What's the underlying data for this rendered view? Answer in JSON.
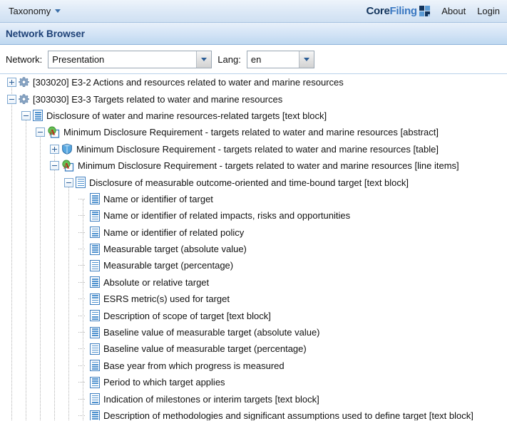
{
  "topbar": {
    "menu_label": "Taxonomy",
    "brand_core": "Core",
    "brand_filing": "Filing",
    "about_label": "About",
    "login_label": "Login"
  },
  "section": {
    "title": "Network Browser"
  },
  "controls": {
    "network_label": "Network:",
    "network_value": "Presentation",
    "lang_label": "Lang:",
    "lang_value": "en"
  },
  "colors": {
    "accent": "#1c4076",
    "brand_core": "#12345c",
    "brand_filing": "#3a78c2",
    "tree_icon_blue": "#3d7ebf",
    "abstract_green": "#4fa93f",
    "abstract_red": "#c1201b"
  },
  "tree": {
    "rows": [
      {
        "depth": 0,
        "toggle": "plus",
        "icon": "gear",
        "label": "[303020] E3-2 Actions and resources related to water and marine resources"
      },
      {
        "depth": 0,
        "toggle": "minus",
        "icon": "gear",
        "label": "[303030] E3-3 Targets related to water and marine resources"
      },
      {
        "depth": 1,
        "toggle": "minus",
        "icon": "doc",
        "label": "Disclosure of water and marine resources-related targets [text block]"
      },
      {
        "depth": 2,
        "toggle": "minus",
        "icon": "abstract",
        "label": "Minimum Disclosure Requirement - targets related to water and marine resources [abstract]"
      },
      {
        "depth": 3,
        "toggle": "plus",
        "icon": "table",
        "label": "Minimum Disclosure Requirement - targets related to water and marine resources [table]"
      },
      {
        "depth": 3,
        "toggle": "minus",
        "icon": "abstract",
        "label": "Minimum Disclosure Requirement - targets related to water and marine resources [line items]"
      },
      {
        "depth": 4,
        "toggle": "minus",
        "icon": "doc",
        "label": "Disclosure of measurable outcome-oriented and time-bound target [text block]"
      },
      {
        "depth": 5,
        "toggle": "none",
        "icon": "doc",
        "label": "Name or identifier of target"
      },
      {
        "depth": 5,
        "toggle": "none",
        "icon": "doc",
        "label": "Name or identifier of related impacts, risks and opportunities"
      },
      {
        "depth": 5,
        "toggle": "none",
        "icon": "doc",
        "label": "Name or identifier of related policy"
      },
      {
        "depth": 5,
        "toggle": "none",
        "icon": "doc",
        "label": "Measurable target (absolute value)"
      },
      {
        "depth": 5,
        "toggle": "none",
        "icon": "doc",
        "label": "Measurable target (percentage)"
      },
      {
        "depth": 5,
        "toggle": "none",
        "icon": "doc",
        "label": "Absolute or relative target"
      },
      {
        "depth": 5,
        "toggle": "none",
        "icon": "doc",
        "label": "ESRS metric(s) used for target"
      },
      {
        "depth": 5,
        "toggle": "none",
        "icon": "doc",
        "label": "Description of scope of target [text block]"
      },
      {
        "depth": 5,
        "toggle": "none",
        "icon": "doc",
        "label": "Baseline value of measurable target (absolute value)"
      },
      {
        "depth": 5,
        "toggle": "none",
        "icon": "doc",
        "label": "Baseline value of measurable target (percentage)"
      },
      {
        "depth": 5,
        "toggle": "none",
        "icon": "doc",
        "label": "Base year from which progress is measured"
      },
      {
        "depth": 5,
        "toggle": "none",
        "icon": "doc",
        "label": "Period to which target applies"
      },
      {
        "depth": 5,
        "toggle": "none",
        "icon": "doc",
        "label": "Indication of milestones or interim targets [text block]"
      },
      {
        "depth": 5,
        "toggle": "none",
        "icon": "doc",
        "label": "Description of methodologies and significant assumptions used to define target [text block]"
      }
    ]
  }
}
